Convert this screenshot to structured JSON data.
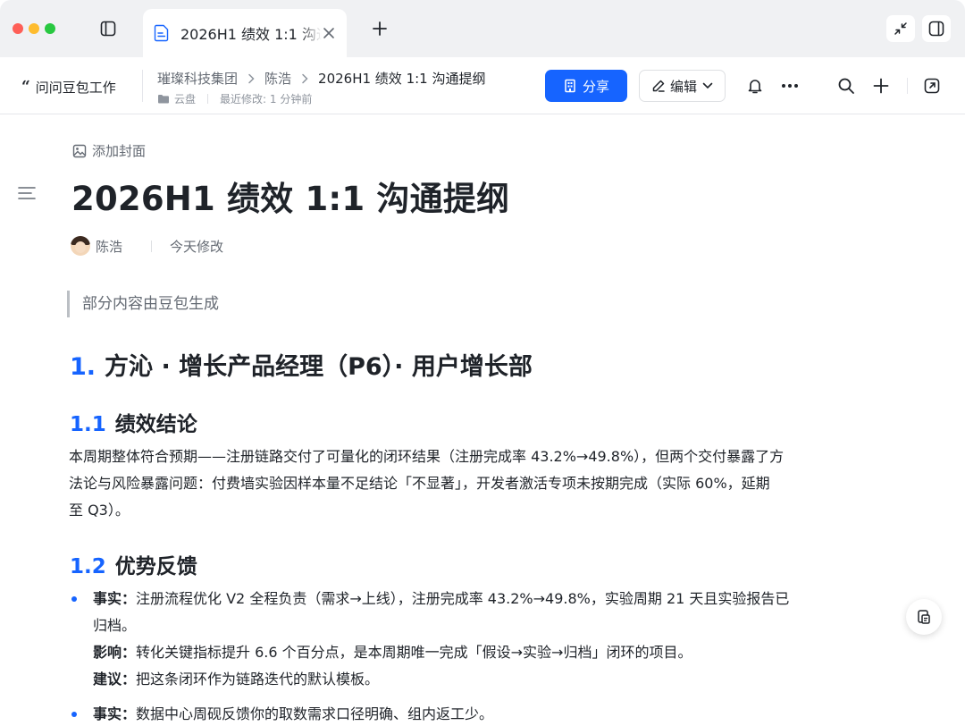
{
  "tab": {
    "title": "2026H1 绩效 1:1 沟通提纲"
  },
  "header": {
    "ask_doubao": "问问豆包工作",
    "breadcrumb": [
      "璀璨科技集团",
      "陈浩",
      "2026H1 绩效 1:1 沟通提纲"
    ],
    "location": "云盘",
    "last_modified": "最近修改: 1 分钟前",
    "share_label": "分享",
    "edit_label": "编辑"
  },
  "doc": {
    "add_cover": "添加封面",
    "title": "2026H1 绩效 1:1 沟通提纲",
    "author": "陈浩",
    "modified": "今天修改",
    "callout": "部分内容由豆包生成",
    "h1": {
      "num": "1.",
      "text": "方沁 · 增长产品经理（P6）· 用户增长部"
    },
    "section_1_1": {
      "num": "1.1",
      "text": "绩效结论"
    },
    "conclusion_lines": [
      "本周期整体符合预期——注册链路交付了可量化的闭环结果（注册完成率 43.2%→49.8%），但两个交付暴露了方",
      "法论与风险暴露问题：付费墙实验因样本量不足结论「不显著」，开发者激活专项未按期完成（实际 60%，延期",
      "至 Q3）。"
    ],
    "section_1_2": {
      "num": "1.2",
      "text": "优势反馈"
    },
    "bullets": [
      {
        "lines": [
          {
            "label": "事实：",
            "text": "注册流程优化 V2 全程负责（需求→上线），注册完成率 43.2%→49.8%，实验周期 21 天且实验报告已"
          },
          {
            "label": "",
            "text": "归档。"
          },
          {
            "label": "影响：",
            "text": "转化关键指标提升 6.6 个百分点，是本周期唯一完成「假设→实验→归档」闭环的项目。"
          },
          {
            "label": "建议：",
            "text": "把这条闭环作为链路迭代的默认模板。"
          }
        ]
      },
      {
        "lines": [
          {
            "label": "事实：",
            "text": "数据中心周砚反馈你的取数需求口径明确、组内返工少。"
          }
        ]
      }
    ]
  },
  "colors": {
    "accent": "#1664ff",
    "text": "#1f2329",
    "muted": "#646a73"
  }
}
